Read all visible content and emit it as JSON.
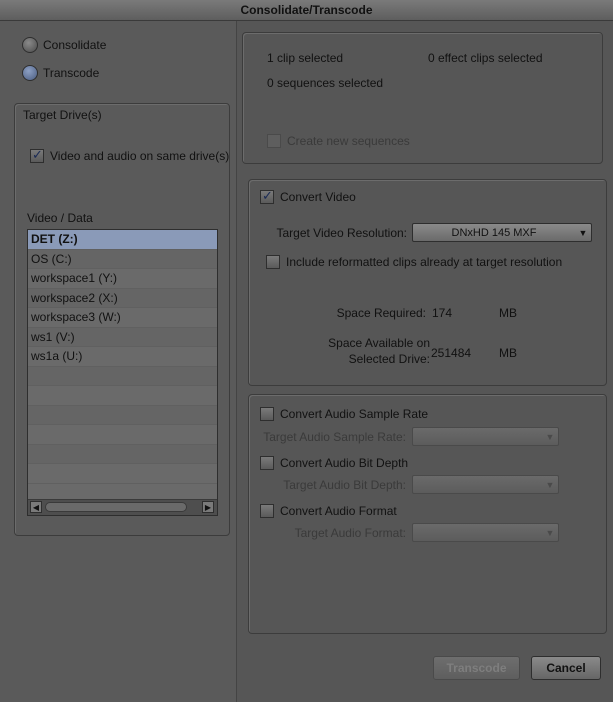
{
  "window": {
    "title": "Consolidate/Transcode"
  },
  "mode": {
    "consolidate_label": "Consolidate",
    "transcode_label": "Transcode",
    "selected": "transcode"
  },
  "target_drives": {
    "title": "Target Drive(s)",
    "same_drive_label": "Video and audio on same drive(s)",
    "same_drive_checked": true,
    "list_header": "Video / Data",
    "drives": [
      "DET (Z:)",
      "OS (C:)",
      "workspace1 (Y:)",
      "workspace2 (X:)",
      "workspace3 (W:)",
      "ws1 (V:)",
      "ws1a (U:)"
    ],
    "selected_index": 0
  },
  "selection": {
    "clips": "1 clip selected",
    "effect_clips": "0 effect clips selected",
    "sequences": "0 sequences selected",
    "create_new_sequences_label": "Create new sequences"
  },
  "video": {
    "convert_label": "Convert Video",
    "resolution_label": "Target Video Resolution:",
    "resolution_value": "DNxHD 145  MXF",
    "include_reformatted_label": "Include reformatted clips already at target resolution",
    "space_required_label": "Space Required:",
    "space_required_value": "174",
    "space_required_unit": "MB",
    "space_available_label_line1": "Space Available on",
    "space_available_label_line2": "Selected Drive:",
    "space_available_value": "251484",
    "space_available_unit": "MB"
  },
  "audio": {
    "sample_rate_label": "Convert Audio Sample Rate",
    "target_sample_rate_label": "Target Audio Sample Rate:",
    "bit_depth_label": "Convert Audio Bit Depth",
    "target_bit_depth_label": "Target Audio Bit Depth:",
    "format_label": "Convert Audio Format",
    "target_format_label": "Target Audio Format:"
  },
  "buttons": {
    "transcode": "Transcode",
    "cancel": "Cancel"
  },
  "icons": {
    "dropdown": "chevron-down-icon",
    "checkmark": "checkmark-icon"
  },
  "colors": {
    "selection": "#8a9ab8",
    "background": "#555555"
  }
}
